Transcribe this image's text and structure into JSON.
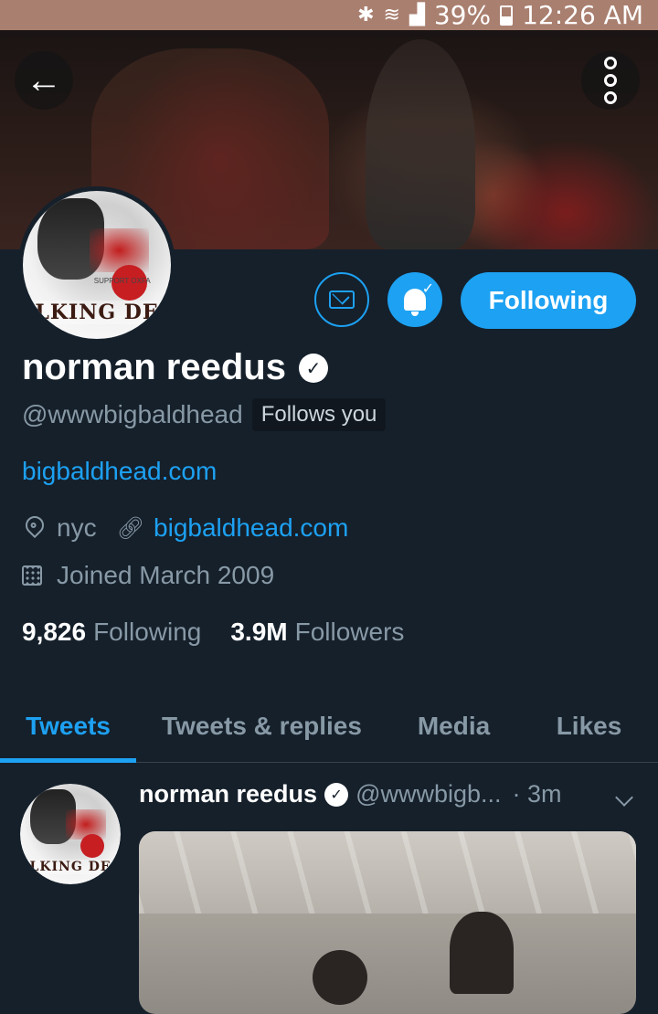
{
  "status_bar": {
    "battery": "39%",
    "time": "12:26 AM"
  },
  "profile": {
    "name": "norman reedus",
    "handle": "@wwwbigbaldhead",
    "follows_you": "Follows you",
    "bio_link": "bigbaldhead.com",
    "location": "nyc",
    "website": "bigbaldhead.com",
    "joined": "Joined March 2009",
    "following_count": "9,826",
    "following_label": "Following",
    "followers_count": "3.9M",
    "followers_label": "Followers",
    "avatar_logo_text": "LKING DE",
    "avatar_small_text": "SUPPORT OXFA"
  },
  "actions": {
    "following_button": "Following"
  },
  "tabs": [
    {
      "label": "Tweets",
      "active": true
    },
    {
      "label": "Tweets & replies",
      "active": false
    },
    {
      "label": "Media",
      "active": false
    },
    {
      "label": "Likes",
      "active": false
    }
  ],
  "tweet": {
    "name": "norman reedus",
    "handle": "@wwwbigb...",
    "time": "· 3m"
  },
  "colors": {
    "background": "#15202b",
    "accent": "#1da1f2",
    "muted_text": "#8899a6",
    "status_bar": "#a97f6f"
  },
  "icons": [
    "back-arrow-icon",
    "more-options-icon",
    "envelope-icon",
    "bell-icon",
    "verified-badge-icon",
    "location-pin-icon",
    "link-icon",
    "calendar-icon",
    "chevron-down-icon"
  ]
}
